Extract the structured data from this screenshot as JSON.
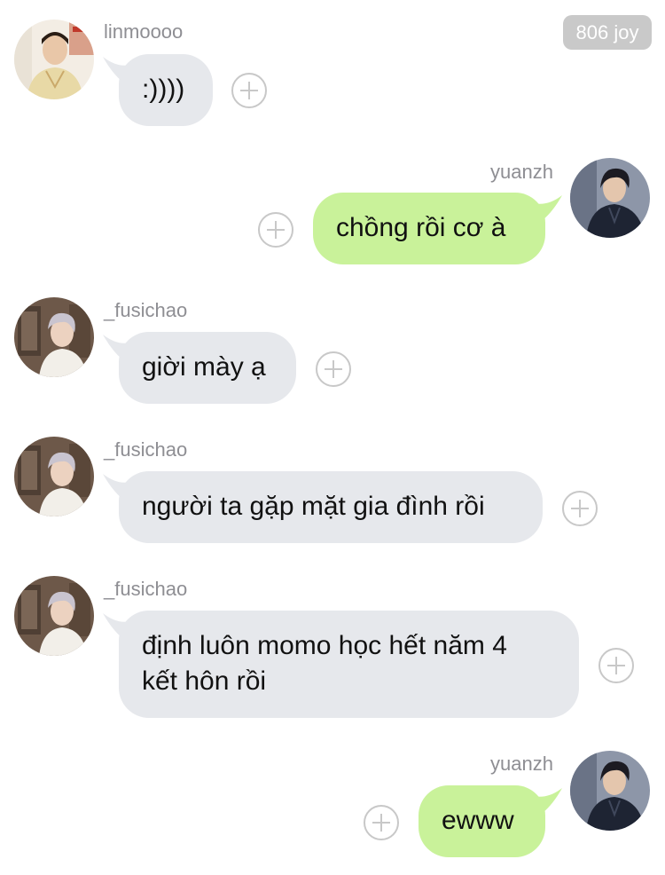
{
  "points_badge": "806 joy",
  "messages": [
    {
      "username": "linmoooo",
      "text": ":))))",
      "side": "incoming",
      "avatar": "linmoooo-avatar-photo"
    },
    {
      "username": "yuanzh",
      "text": "chồng rồi cơ à",
      "side": "outgoing",
      "avatar": "yuanzh-avatar-photo"
    },
    {
      "username": "_fusichao",
      "text": "giời mày ạ",
      "side": "incoming",
      "avatar": "fusichao-avatar-photo"
    },
    {
      "username": "_fusichao",
      "text": "người ta gặp mặt gia đình rồi",
      "side": "incoming",
      "avatar": "fusichao-avatar-photo"
    },
    {
      "username": "_fusichao",
      "text_lines": [
        "định luôn momo học hết năm 4",
        "kết hôn rồi"
      ],
      "side": "incoming",
      "avatar": "fusichao-avatar-photo"
    },
    {
      "username": "yuanzh",
      "text": "ewww",
      "side": "outgoing",
      "avatar": "yuanzh-avatar-photo"
    }
  ],
  "icons": {
    "add_reaction": "plus-circle-icon"
  },
  "colors": {
    "incoming_bubble": "#e6e8ec",
    "outgoing_bubble": "#c9f29a",
    "username_text": "#8e8e93",
    "badge_background": "#c9c9c9"
  }
}
